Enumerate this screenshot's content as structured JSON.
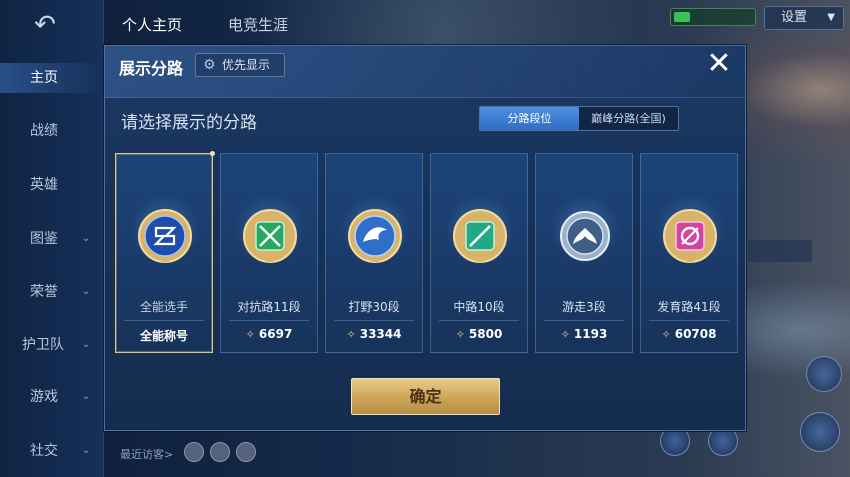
{
  "left_nav": {
    "back_icon": "back-arrow-icon",
    "items": [
      {
        "label": "主页",
        "active": true,
        "expandable": false
      },
      {
        "label": "战绩",
        "active": false,
        "expandable": false
      },
      {
        "label": "英雄",
        "active": false,
        "expandable": false
      },
      {
        "label": "图鉴",
        "active": false,
        "expandable": true
      },
      {
        "label": "荣誉",
        "active": false,
        "expandable": true
      },
      {
        "label": "护卫队",
        "active": false,
        "expandable": true
      },
      {
        "label": "游戏",
        "active": false,
        "expandable": true
      },
      {
        "label": "社交",
        "active": false,
        "expandable": true
      }
    ]
  },
  "top_tabs": [
    {
      "label": "个人主页",
      "active": true
    },
    {
      "label": "电竞生涯",
      "active": false
    }
  ],
  "top_right": {
    "settings_label": "设置"
  },
  "bottom_bar": {
    "recent_label": "最近访客>"
  },
  "modal": {
    "title": "展示分路",
    "priority_label": "优先显示",
    "close_icon": "close-icon",
    "subtitle": "请选择展示的分路",
    "segmented": [
      {
        "label": "分路段位",
        "selected": true
      },
      {
        "label": "巅峰分路(全国)",
        "selected": false
      }
    ],
    "cards": [
      {
        "name": "全能选手",
        "footer": "全能称号",
        "points": null,
        "selected": true,
        "icon": "all-round-emblem-icon",
        "color": "#2f6fd6"
      },
      {
        "name": "对抗路11段",
        "footer": "6697",
        "points": true,
        "selected": false,
        "icon": "clash-lane-emblem-icon",
        "color": "#2ab56a"
      },
      {
        "name": "打野30段",
        "footer": "33344",
        "points": true,
        "selected": false,
        "icon": "jungle-emblem-icon",
        "color": "#3a82d9"
      },
      {
        "name": "中路10段",
        "footer": "5800",
        "points": true,
        "selected": false,
        "icon": "mid-lane-emblem-icon",
        "color": "#25b38a"
      },
      {
        "name": "游走3段",
        "footer": "1193",
        "points": true,
        "selected": false,
        "icon": "roam-emblem-icon",
        "color": "#8aa7c8"
      },
      {
        "name": "发育路41段",
        "footer": "60708",
        "points": true,
        "selected": false,
        "icon": "farm-lane-emblem-icon",
        "color": "#d84aa8"
      }
    ],
    "confirm_label": "确定"
  }
}
